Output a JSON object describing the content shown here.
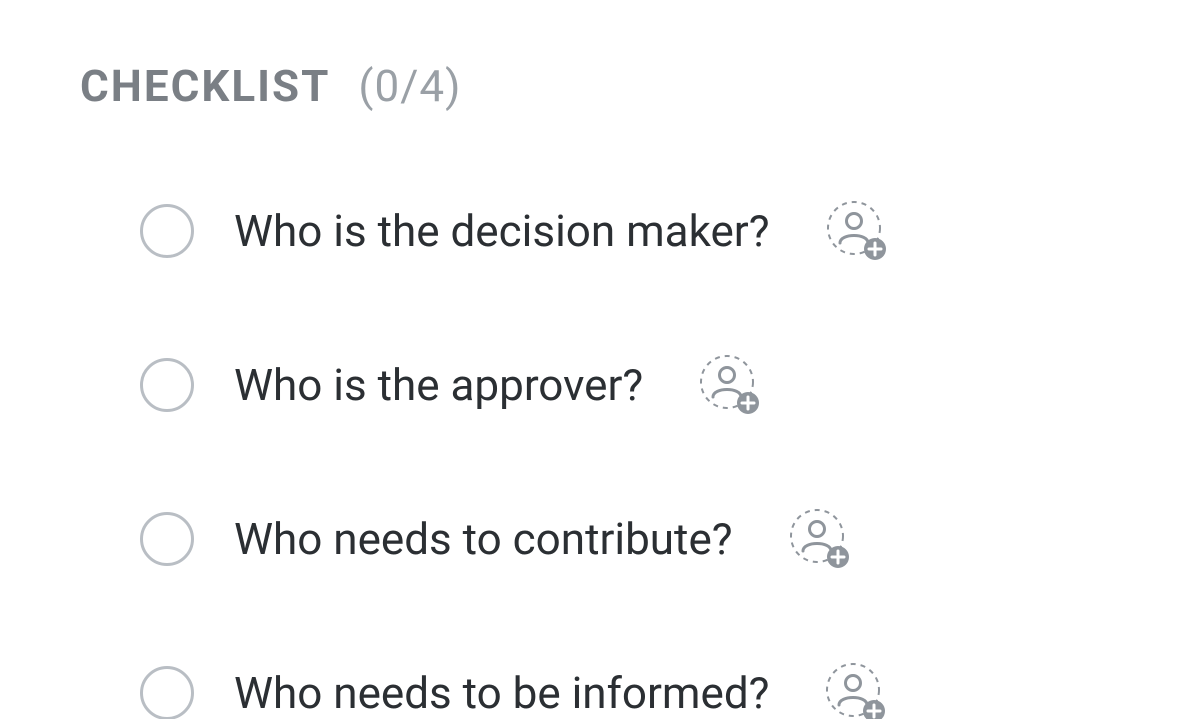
{
  "checklist": {
    "title": "CHECKLIST",
    "count_text": "(0/4)",
    "completed": 0,
    "total": 4,
    "items": [
      {
        "label": "Who is the decision maker?",
        "checked": false
      },
      {
        "label": "Who is the approver?",
        "checked": false
      },
      {
        "label": "Who needs to contribute?",
        "checked": false
      },
      {
        "label": "Who needs to be informed?",
        "checked": false
      }
    ]
  },
  "colors": {
    "title_grey": "#7a7f85",
    "count_grey": "#9aa0a6",
    "checkbox_border": "#b9bec4",
    "text": "#2b2f33",
    "assign_grey": "#8f959c"
  }
}
